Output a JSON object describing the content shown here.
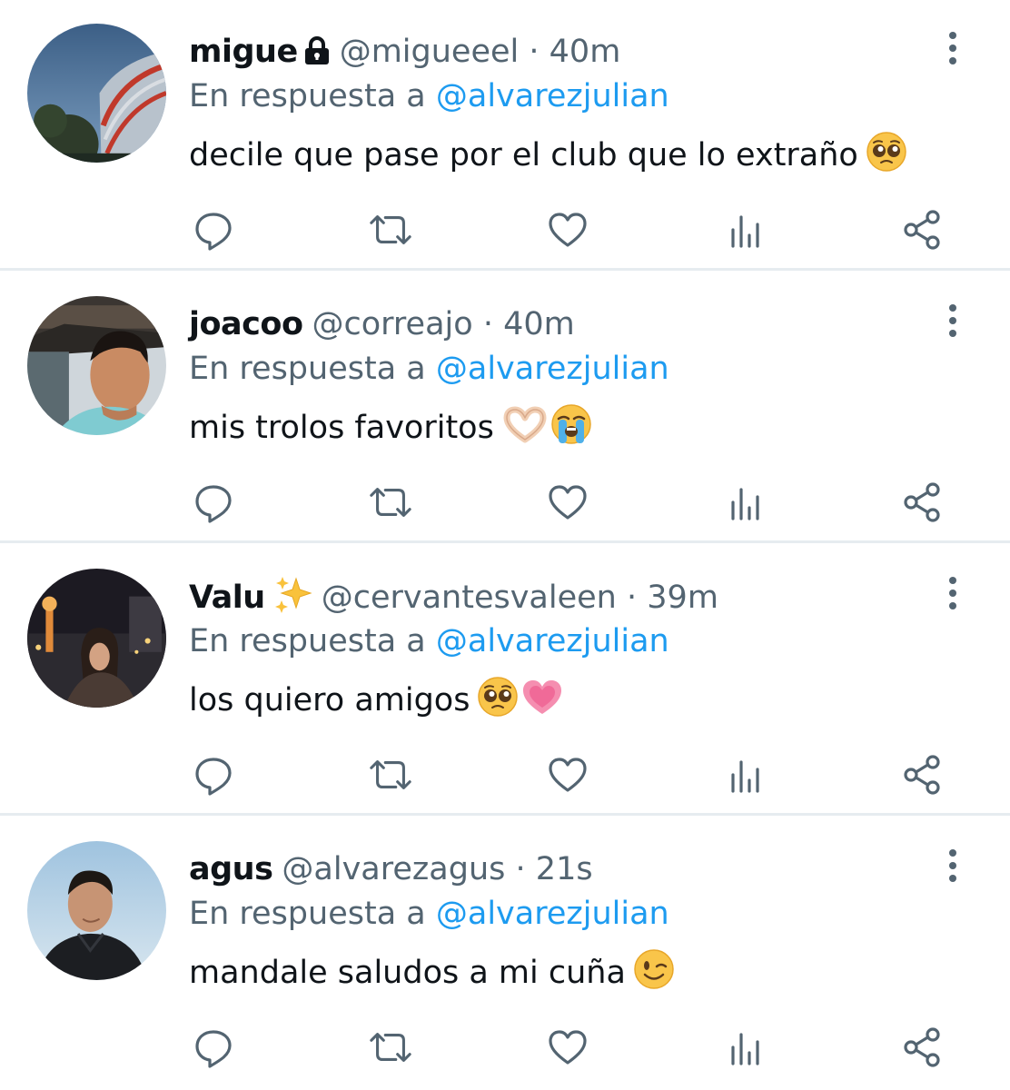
{
  "colors": {
    "text_primary": "#0f1419",
    "text_secondary": "#536471",
    "mention": "#1d9bf0",
    "divider": "#e6ecf0"
  },
  "tweets": [
    {
      "name": "migue",
      "badge_icon": "lock-icon",
      "handle": "@migueeel",
      "separator": "·",
      "time": "40m",
      "reply_prefix": "En respuesta a",
      "reply_mention": "@alvarezjulian",
      "text": "decile que pase por el club que lo extraño",
      "emojis": [
        "pleading-face-emoji"
      ]
    },
    {
      "name": "joacoo",
      "handle": "@correajo",
      "separator": "·",
      "time": "40m",
      "reply_prefix": "En respuesta a",
      "reply_mention": "@alvarezjulian",
      "text": "mis trolos favoritos",
      "emojis": [
        "heart-hands-emoji",
        "loudly-crying-face-emoji"
      ]
    },
    {
      "name": "Valu",
      "badge_icon": "sparkles-icon",
      "handle": "@cervantesvaleen",
      "separator": "·",
      "time": "39m",
      "reply_prefix": "En respuesta a",
      "reply_mention": "@alvarezjulian",
      "text": "los quiero amigos",
      "emojis": [
        "pleading-face-emoji",
        "growing-heart-emoji"
      ]
    },
    {
      "name": "agus",
      "handle": "@alvarezagus",
      "separator": "·",
      "time": "21s",
      "reply_prefix": "En respuesta a",
      "reply_mention": "@alvarezjulian",
      "text": "mandale saludos a mi cuña",
      "emojis": [
        "winking-face-emoji"
      ]
    }
  ],
  "actions": [
    "reply-icon",
    "retweet-icon",
    "like-icon",
    "analytics-icon",
    "share-icon"
  ]
}
